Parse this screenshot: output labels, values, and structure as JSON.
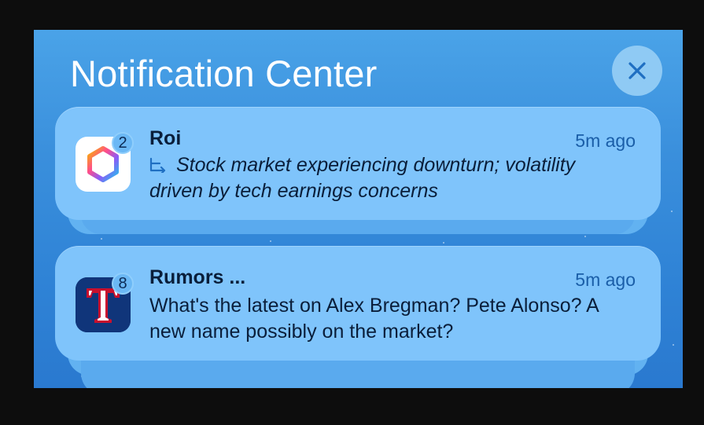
{
  "header": {
    "title": "Notification Center",
    "close_icon": "close-icon"
  },
  "notifications": [
    {
      "app": "Roi",
      "icon": "roi-hexagon-icon",
      "badge": "2",
      "time": "5m ago",
      "body": "Stock market experiencing downturn; volatility driven by tech earnings concerns",
      "lead_icon": "summary-icon"
    },
    {
      "app": "Rumors ...",
      "icon": "rangers-t-icon",
      "badge": "8",
      "time": "5m ago",
      "body": "What's the latest on Alex Bregman? Pete Alonso? A new name possibly on the market?"
    }
  ],
  "colors": {
    "panel_top": "#4aa3e8",
    "panel_bottom": "#2a79cf",
    "card": "#7fc4fb",
    "close_button": "#8fcaf4",
    "time_text": "#1a5ea8"
  }
}
